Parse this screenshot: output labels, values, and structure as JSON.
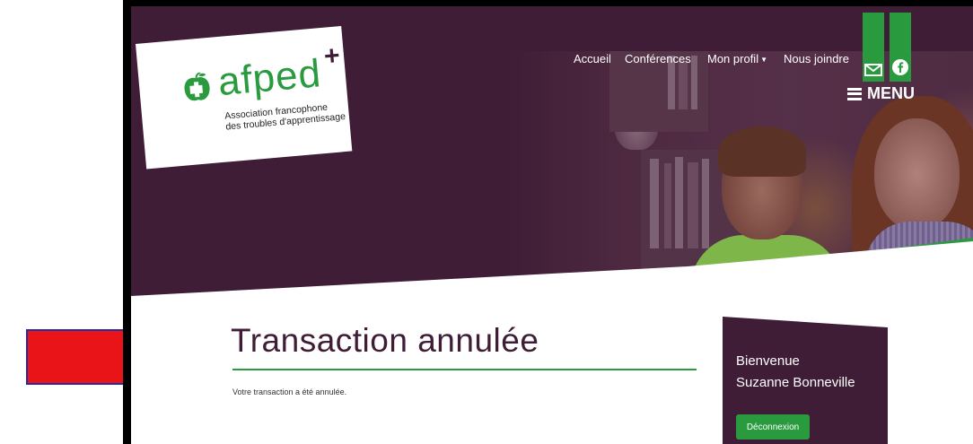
{
  "colors": {
    "brand_purple": "#3f1d36",
    "brand_green": "#2a9a3f",
    "arrow_red": "#e81418"
  },
  "logo": {
    "wordmark": "afped",
    "plus": "+",
    "tagline_line1": "Association francophone",
    "tagline_line2": "des troubles d'apprentissage",
    "icon": "apple-puzzle-icon"
  },
  "nav": {
    "home": "Accueil",
    "conferences": "Conférences",
    "profile": "Mon profil",
    "contact": "Nous joindre",
    "email_icon": "mail-icon",
    "facebook_icon": "facebook-icon",
    "menu_label": "MENU",
    "menu_icon": "hamburger-icon"
  },
  "content": {
    "title": "Transaction annulée",
    "message": "Votre transaction a été annulée."
  },
  "sidebar": {
    "welcome_line1": "Bienvenue",
    "welcome_line2": "Suzanne Bonneville",
    "logout": "Déconnexion"
  },
  "annotation": {
    "icon": "red-arrow-icon"
  }
}
